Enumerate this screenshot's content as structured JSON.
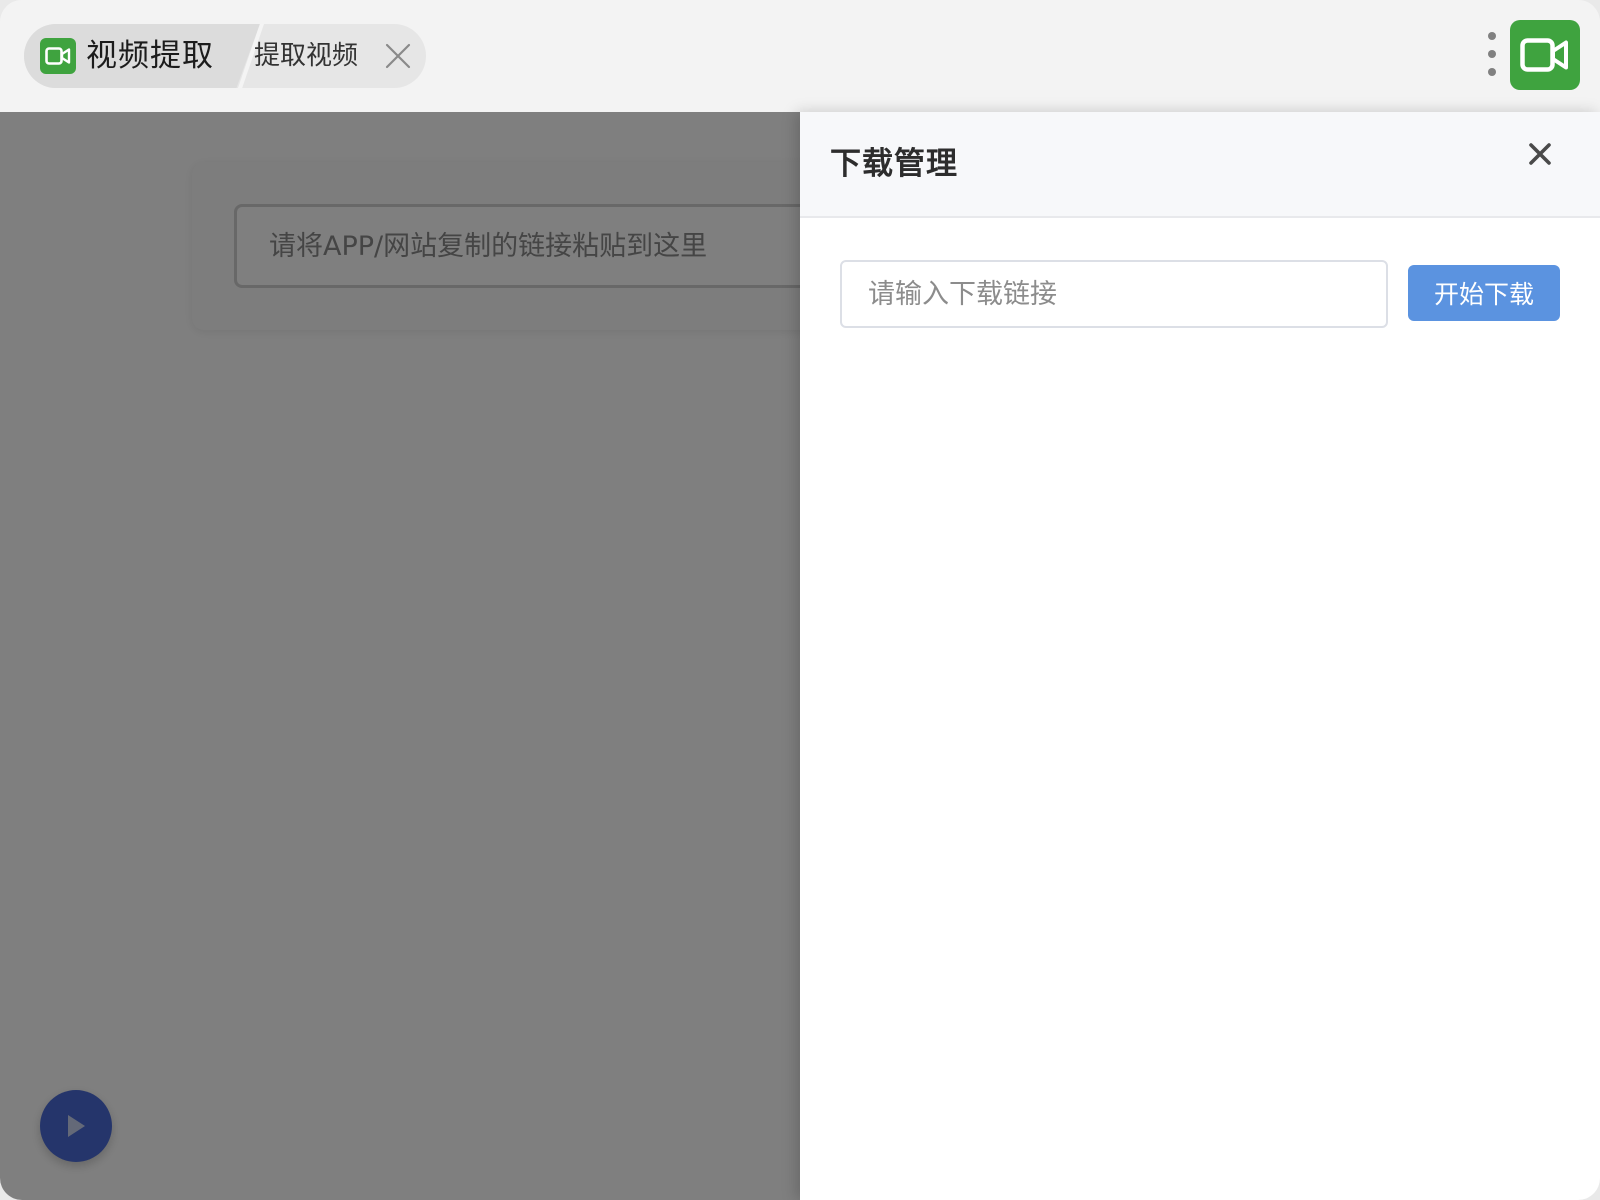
{
  "tabs": {
    "active_title": "视频提取",
    "second_title": "提取视频"
  },
  "icons": {
    "app": "video-camera-icon",
    "close_tab": "close-icon",
    "menu": "more-vertical-icon",
    "drawer_close": "close-icon",
    "fab": "play-icon"
  },
  "colors": {
    "brand_green": "#3fa33f",
    "primary_blue": "#5b93e0",
    "fab_blue": "#4a6bd6"
  },
  "main": {
    "paste_placeholder": "请将APP/网站复制的链接粘贴到这里"
  },
  "drawer": {
    "title": "下载管理",
    "input_placeholder": "请输入下载链接",
    "start_button": "开始下载"
  }
}
